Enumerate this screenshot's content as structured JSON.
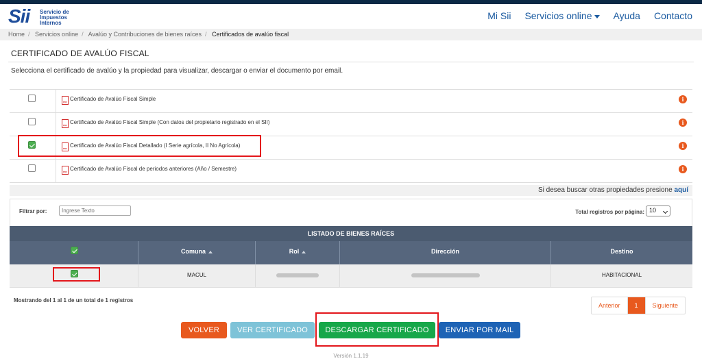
{
  "header": {
    "logo_mark": "Sii",
    "logo_lines": [
      "Servicio de",
      "Impuestos",
      "Internos"
    ],
    "nav": [
      "Mi Sii",
      "Servicios online",
      "Ayuda",
      "Contacto"
    ]
  },
  "breadcrumb": [
    "Home",
    "Servicios online",
    "Avalúo y Contribuciones de bienes raíces",
    "Certificados de avalúo fiscal"
  ],
  "page": {
    "title": "CERTIFICADO DE AVALÚO FISCAL",
    "subtitle": "Selecciona el certificado de avalúo y la propiedad para visualizar, descargar o enviar el documento por email."
  },
  "certificates": [
    {
      "label": "Certificado de Avalúo Fiscal Simple",
      "checked": false
    },
    {
      "label": "Certificado de Avalúo Fiscal Simple (Con datos del propietario registrado en el SII)",
      "checked": false
    },
    {
      "label": "Certificado de Avalúo Fiscal Detallado (I Serie agrícola, II No Agrícola)",
      "checked": true
    },
    {
      "label": "Certificado de Avalúo Fiscal de periodos anteriores (Año / Semestre)",
      "checked": false
    }
  ],
  "search_hint": {
    "text": "Si desea buscar otras propiedades presione ",
    "link": "aquí"
  },
  "filter": {
    "label": "Filtrar por:",
    "placeholder": "Ingrese Texto"
  },
  "per_page": {
    "label": "Total registros por página:",
    "value": "10"
  },
  "table": {
    "title": "LISTADO DE BIENES RAÍCES",
    "columns": [
      "Comuna",
      "Rol",
      "Dirección",
      "Destino"
    ],
    "rows": [
      {
        "checked": true,
        "comuna": "MACUL",
        "destino": "HABITACIONAL"
      }
    ]
  },
  "showing": "Mostrando del 1 al 1 de un total de 1 registros",
  "pager": {
    "prev": "Anterior",
    "page": "1",
    "next": "Siguiente"
  },
  "buttons": {
    "volver": "VOLVER",
    "ver": "VER CERTIFICADO",
    "descargar": "DESCARGAR CERTIFICADO",
    "enviar": "ENVIAR POR MAIL"
  },
  "colors": {
    "orange": "#e8591e",
    "green": "#17a74a",
    "blue": "#1e63b5",
    "light_blue": "#7ec3d8",
    "header_slate": "#4b5b70"
  },
  "version": "Versión 1.1.19"
}
